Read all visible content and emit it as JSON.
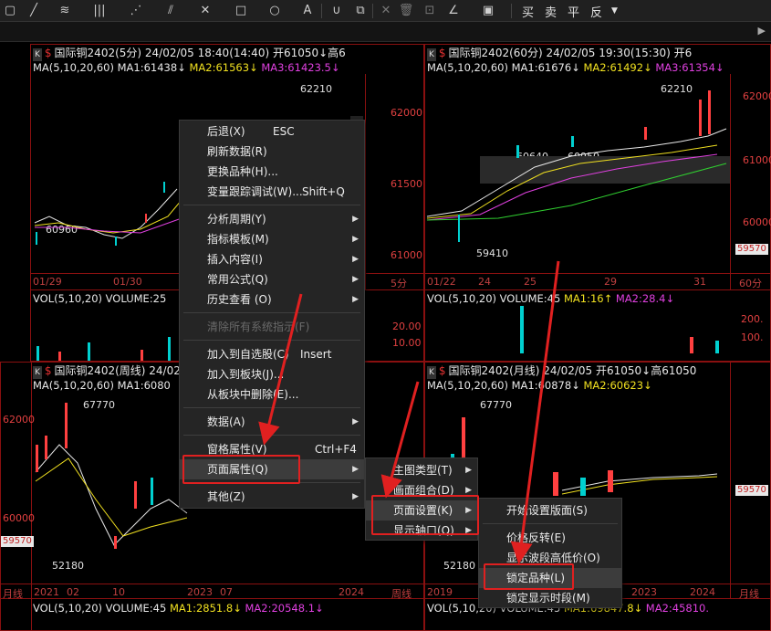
{
  "toolbar": {
    "icons": [
      "draw-cursor-icon",
      "line-icon",
      "text-tool-icon",
      "bars-icon",
      "fan-icon",
      "parallel-icon",
      "cross-icon",
      "rect-icon",
      "circle-icon",
      "letter-a-icon",
      "magnet-icon",
      "copy-icon",
      "delete-icon",
      "lock-icon",
      "pen-icon",
      "save-icon"
    ],
    "trade_buttons": [
      "买",
      "卖",
      "平",
      "反"
    ]
  },
  "panels": {
    "tl": {
      "title": "国际铜2402(5分)  24/02/05  18:40(14:40)  开61050↓高6",
      "ma_head": "MA(5,10,20,60)",
      "ma1": "MA1:61438↓",
      "ma2": "MA2:61563↓",
      "ma3": "MA3:61423.5↓",
      "prices": [
        "62000",
        "61500",
        "61000"
      ],
      "notes": [
        "62210",
        "60960"
      ],
      "xlabels": [
        "01/29",
        "01/30"
      ],
      "period": "5分",
      "vol_title": "VOL(5,10,20)  VOLUME:25",
      "vol_axis": [
        "20.00",
        "10.00"
      ]
    },
    "tr": {
      "title": "国际铜2402(60分)  24/02/05  19:30(15:30)  开6",
      "ma_head": "MA(5,10,20,60)",
      "ma1": "MA1:61676↓",
      "ma2": "MA2:61492↓",
      "ma3": "MA3:61354↓",
      "prices": [
        "62000",
        "61000",
        "60000"
      ],
      "price_tag": "59570",
      "notes": [
        "62210",
        "60640",
        "60950",
        "59410"
      ],
      "xlabels": [
        "01/22",
        "24",
        "25",
        "29",
        "31"
      ],
      "period": "60分",
      "vol_title": "VOL(5,10,20)  VOLUME:45",
      "vol_ma1": "MA1:16↑",
      "vol_ma2": "MA2:28.4↓",
      "vol_axis": [
        "200.",
        "100."
      ]
    },
    "bl": {
      "title": "国际铜2402(周线)  24/02/05",
      "ma_head": "MA(5,10,20,60)",
      "ma1": "MA1:6080",
      "prices": [
        "62000",
        "60000"
      ],
      "price_tag": "59570",
      "notes": [
        "67770",
        "52180"
      ],
      "xlabels": [
        "2021",
        "02",
        "10",
        "2023",
        "07",
        "2024"
      ],
      "period": "周线",
      "vol_title": "VOL(5,10,20)  VOLUME:45",
      "vol_ma1": "MA1:2851.8↓",
      "vol_ma2": "MA2:20548.1↓"
    },
    "br": {
      "title": "国际铜2402(月线)  24/02/05  开61050↓高61050",
      "ma_head": "MA(5,10,20,60)",
      "ma1": "MA1:60878↓",
      "ma2": "MA2:60623↓",
      "price_tag": "59570",
      "notes": [
        "67770",
        "52180"
      ],
      "xlabels": [
        "2019",
        "2021",
        "2023",
        "2024"
      ],
      "period": "月线",
      "vol_title": "VOL(5,10,20)  VOLUME:45",
      "vol_ma1": "MA1:69847.8↓",
      "vol_ma2": "MA2:45810."
    }
  },
  "context_menu": {
    "items": [
      {
        "label": "后退(X)",
        "shortcut": "ESC"
      },
      {
        "label": "刷新数据(R)"
      },
      {
        "label": "更换品种(H)..."
      },
      {
        "label": "变量跟踪调试(W)...",
        "shortcut": "Shift+Q"
      },
      {
        "label": "分析周期(Y)",
        "submenu": true
      },
      {
        "label": "指标模板(M)",
        "submenu": true
      },
      {
        "label": "插入内容(I)",
        "submenu": true
      },
      {
        "label": "常用公式(Q)",
        "submenu": true
      },
      {
        "label": "历史查看 (O)",
        "submenu": true
      },
      {
        "label": "清除所有系统指示(F)",
        "disabled": true
      },
      {
        "label": "加入到自选股(C)",
        "shortcut": "Insert"
      },
      {
        "label": "加入到板块(J)..."
      },
      {
        "label": "从板块中删除(E)..."
      },
      {
        "label": "数据(A)",
        "submenu": true
      },
      {
        "label": "窗格属性(V)",
        "shortcut": "Ctrl+F4"
      },
      {
        "label": "页面属性(Q)",
        "submenu": true
      },
      {
        "label": "其他(Z)",
        "submenu": true
      }
    ]
  },
  "page_menu": {
    "items": [
      {
        "label": "主图类型(T)",
        "submenu": true
      },
      {
        "label": "画面组合(D)",
        "submenu": true
      },
      {
        "label": "页面设置(K)",
        "submenu": true
      },
      {
        "label": "显示轴口(Q)",
        "submenu": true
      }
    ]
  },
  "settings_menu": {
    "items": [
      {
        "label": "开始设置版面(S)"
      },
      {
        "label": "价格反转(E)"
      },
      {
        "label": "显示波段高低价(O)"
      },
      {
        "label": "锁定品种(L)"
      },
      {
        "label": "锁定显示时段(M)"
      }
    ]
  },
  "colors": {
    "frame": "#8a1010",
    "up": "#ff4040",
    "down": "#00d0d0",
    "ma1": "#e8e8e8",
    "ma2": "#f0e020",
    "ma3": "#e040e0",
    "ma4": "#30d030",
    "annotation": "#e02020"
  }
}
